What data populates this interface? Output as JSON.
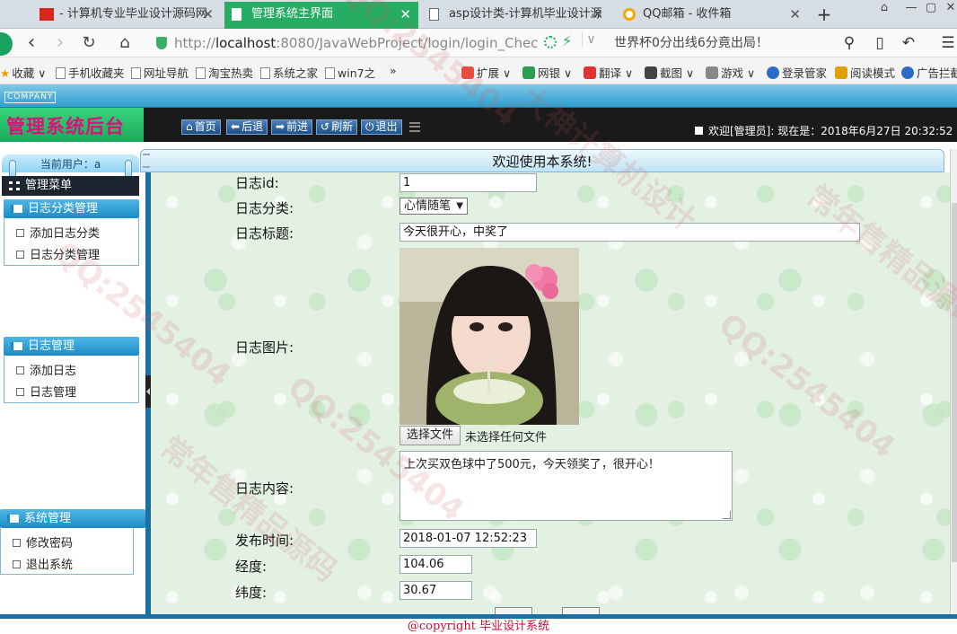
{
  "browser": {
    "tabs": [
      {
        "label": "- 计算机专业毕业设计源码网",
        "active": false,
        "icon": "flag-icon"
      },
      {
        "label": "管理系统主界面",
        "active": true,
        "icon": "page-icon"
      },
      {
        "label": "asp设计类-计算机毕业设计源",
        "active": false,
        "icon": "page-icon"
      },
      {
        "label": "QQ邮箱 - 收件箱",
        "active": false,
        "icon": "qq-mail-icon"
      }
    ],
    "close_glyph": "✕",
    "new_tab_glyph": "+",
    "address": {
      "prefix": "http://",
      "host": "localhost",
      "rest": ":8080/JavaWebProject/login/login_Chec"
    },
    "news": "世界杯0分出线6分竟出局！",
    "bookmarks": [
      {
        "label": "收藏",
        "dropdown": true
      },
      {
        "label": "手机收藏夹"
      },
      {
        "label": "网址导航"
      },
      {
        "label": "淘宝热卖"
      },
      {
        "label": "系统之家"
      },
      {
        "label": "win7之"
      },
      {
        "label": "»"
      }
    ],
    "extensions": [
      {
        "label": "扩展",
        "color": "#e84c3d"
      },
      {
        "label": "网银",
        "color": "#2d9e4f"
      },
      {
        "label": "翻译",
        "color": "#d33"
      },
      {
        "label": "截图",
        "color": "#444"
      },
      {
        "label": "游戏",
        "color": "#888"
      },
      {
        "label": "登录管家",
        "color": "#2b6cc4"
      },
      {
        "label": "阅读模式",
        "color": "#e0a100"
      },
      {
        "label": "广告拦截",
        "color": "#2b6cc4"
      }
    ]
  },
  "app": {
    "company_tag": "COMPANY",
    "brand": "管理系统后台",
    "top_buttons": [
      "首页",
      "后退",
      "前进",
      "刷新",
      "退出"
    ],
    "welcome": "欢迎[管理员]: 现在是：2018年6月27日 20:32:52"
  },
  "sidebar": {
    "current_user": "当前用户：a",
    "menu_title": "管理菜单",
    "groups": [
      {
        "title": "日志分类管理",
        "items": [
          "添加日志分类",
          "日志分类管理"
        ]
      },
      {
        "title": "日志管理",
        "items": [
          "添加日志",
          "日志管理"
        ]
      },
      {
        "title": "系统管理",
        "items": [
          "修改密码",
          "退出系统"
        ]
      }
    ]
  },
  "main": {
    "welcome_title": "欢迎使用本系统!",
    "form": {
      "id_label": "日志id:",
      "id_value": "1",
      "category_label": "日志分类:",
      "category_value": "心情随笔",
      "title_label": "日志标题:",
      "title_value": "今天很开心，中奖了",
      "image_label": "日志图片:",
      "file_button": "选择文件",
      "file_status": "未选择任何文件",
      "content_label": "日志内容:",
      "content_value": "上次买双色球中了500元，今天领奖了，很开心！",
      "time_label": "发布时间:",
      "time_value": "2018-01-07 12:52:23",
      "lng_label": "经度:",
      "lng_value": "104.06",
      "lat_label": "纬度:",
      "lat_value": "30.67"
    }
  },
  "footer": "@copyright 毕业设计系统",
  "watermark": [
    "QQ:2545404",
    "大神计算机设计",
    "常年售精品源码"
  ]
}
